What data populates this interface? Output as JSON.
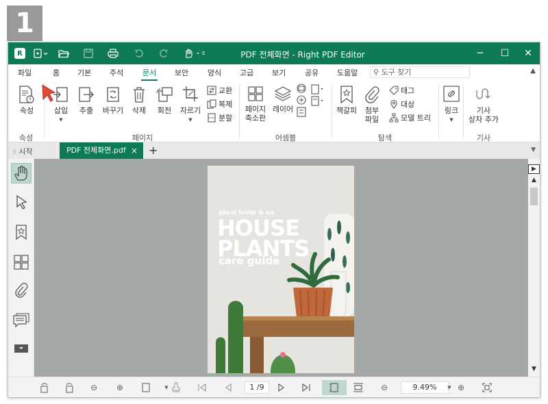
{
  "step_number": "1",
  "window": {
    "title": "PDF 전체화면 - Right PDF Editor"
  },
  "menu": [
    {
      "label": "파일"
    },
    {
      "label": "홈"
    },
    {
      "label": "기본"
    },
    {
      "label": "주석"
    },
    {
      "label": "문서"
    },
    {
      "label": "보안"
    },
    {
      "label": "양식"
    },
    {
      "label": "고급"
    },
    {
      "label": "보기"
    },
    {
      "label": "공유"
    },
    {
      "label": "도움말"
    }
  ],
  "search": {
    "placeholder": "도구 찾기"
  },
  "ribbon": {
    "properties": "속성",
    "insert": "삽입",
    "extract": "추출",
    "replace": "바꾸기",
    "delete": "삭제",
    "rotate": "회전",
    "crop": "자르기",
    "swap": "교환",
    "duplicate": "복제",
    "split": "분할",
    "page_thumbnails_1": "페이지",
    "page_thumbnails_2": "축소판",
    "layer": "레이어",
    "bookmark": "책갈피",
    "attach_1": "첨부",
    "attach_2": "파일",
    "tag": "태그",
    "target": "대상",
    "model_tree": "모델 트리",
    "link": "링크",
    "article_1": "기사",
    "article_2": "상자 추가",
    "group_properties": "속성",
    "group_page": "페이지",
    "group_assemble": "어셈블",
    "group_navigate": "탐색",
    "group_article": "기사"
  },
  "tabs": {
    "start": "시작",
    "document": "PDF 전체화면.pdf",
    "close": "×",
    "add": "+"
  },
  "document": {
    "small": "plant lover & co.",
    "line1": "HOUSE",
    "line2": "PLANTS",
    "line3": "care guide"
  },
  "status": {
    "page": "1 /9",
    "zoom": "9.49%"
  },
  "colors": {
    "accent": "#0d7a55",
    "canvas": "#a4a8a6",
    "cursor": "#e24a3b"
  }
}
